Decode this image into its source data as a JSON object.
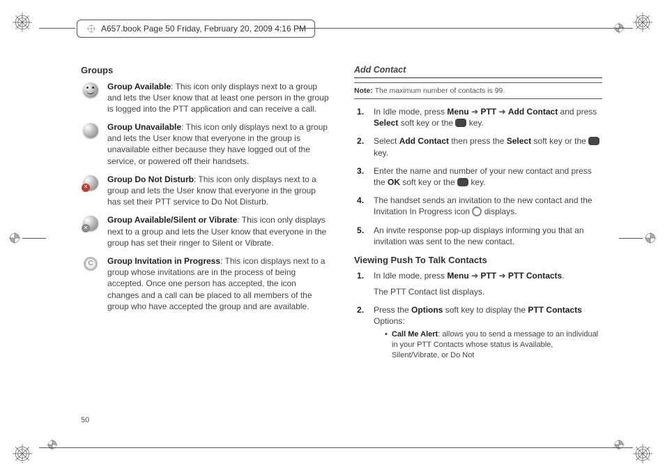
{
  "header": {
    "text": "A657.book  Page 50  Friday, February 20, 2009  4:16 PM"
  },
  "page_number": "50",
  "left": {
    "heading": "Groups",
    "items": [
      {
        "title": "Group Available",
        "desc": ": This icon only displays next to a group and lets the User know that at least one person in the group is logged into the PTT application and can receive a call."
      },
      {
        "title": "Group Unavailable",
        "desc": ": This icon only displays next to a group and lets the User know that everyone in the group is unavailable either because they have logged out of the service, or powered off their handsets."
      },
      {
        "title": "Group Do Not Disturb",
        "desc": ": This icon only displays next to a group and lets the User know that everyone in the group has set their PTT service to Do Not Disturb."
      },
      {
        "title": "Group Available/Silent or Vibrate",
        "desc": ": This icon only displays next to a group and lets the User know that everyone in the group has set their ringer to Silent or Vibrate."
      },
      {
        "title": "Group Invitation in Progress",
        "desc": ": This icon displays next to a group whose invitations are in the process of being accepted. Once one person has accepted, the icon changes and a call can be placed to all members of the group who have accepted the group and are available."
      }
    ]
  },
  "right": {
    "add_heading": "Add Contact",
    "note_label": "Note:",
    "note_text": " The maximum number of contacts is 99.",
    "steps1": [
      {
        "pre": "In Idle mode, press ",
        "b1": "Menu",
        "arrow1": " ➔ ",
        "b2": "PTT",
        "arrow2": " ➔ ",
        "b3": "Add Contact",
        "post1": " and press ",
        "b4": "Select",
        "post2": " soft key or the ",
        "post3": " key."
      },
      {
        "pre": "Select ",
        "b1": "Add Contact",
        "post1": " then press the ",
        "b2": "Select",
        "post2": " soft key or the ",
        "post3": " key."
      },
      {
        "pre": "Enter the name and number of your new contact and press the ",
        "b1": "OK",
        "post1": " soft key or the ",
        "post2": " key."
      },
      {
        "pre": "The handset sends an invitation to the new contact and the Invitation In Progress icon ",
        "post1": " displays."
      },
      {
        "pre": "An invite response pop-up displays informing you that an invitation was sent to the new contact."
      }
    ],
    "view_heading": "Viewing Push To Talk Contacts",
    "steps2": [
      {
        "pre": "In Idle mode, press ",
        "b1": "Menu",
        "arrow1": " ➔ ",
        "b2": "PTT",
        "arrow2": " ➔ ",
        "b3": "PTT Contacts",
        "post1": ".",
        "line2": "The PTT Contact list displays."
      },
      {
        "pre": "Press the ",
        "b1": "Options",
        "post1": " soft key to display the ",
        "b2": "PTT Contacts",
        "post2": " Options:"
      }
    ],
    "bullet": {
      "b": "Call Me Alert",
      "text": ": allows you to send a message to an individual in your PTT Contacts whose status is Available, Silent/Vibrate, or Do Not"
    }
  }
}
